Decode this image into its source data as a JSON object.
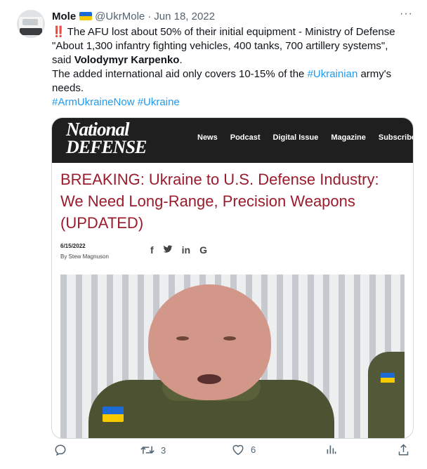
{
  "tweet": {
    "author_name": "Mole",
    "handle": "@UkrMole",
    "separator": "·",
    "date": "Jun 18, 2022",
    "more_label": "···",
    "line1_bang": "‼️",
    "line1": "The AFU lost about 50% of their initial equipment - Ministry of Defense",
    "line2": "\"About 1,300 infantry fighting vehicles, 400 tanks, 700 artillery systems\",",
    "line3_prefix": "said ",
    "line3_name": "Volodymyr Karpenko",
    "line3_suffix": ".",
    "line4_prefix": "The added international aid only covers 10-15% of the ",
    "line4_link": "#Ukrainian",
    "line4_suffix": " army's",
    "line5": "needs.",
    "hashtag1": "#ArmUkraineNow",
    "hashtag2": "#Ukraine"
  },
  "card": {
    "logo_line1": "National",
    "logo_line2": "DEFENSE",
    "nav": [
      "News",
      "Podcast",
      "Digital Issue",
      "Magazine",
      "Subscribe"
    ],
    "headline_line1": "BREAKING: Ukraine to U.S. Defense Industry:",
    "headline_line2": "We Need Long-Range, Precision Weapons",
    "headline_line3": "(UPDATED)",
    "article_date": "6/15/2022",
    "byline": "By Stew Magnuson",
    "share_icons": [
      "f",
      "facebook-icon",
      "twitter-icon",
      "linkedin-icon",
      "google-icon"
    ],
    "share_glyphs": {
      "facebook": "f",
      "twitter": "🐦",
      "linkedin": "in",
      "google": "G"
    }
  },
  "actions": {
    "reply_count": "",
    "retweet_count": "3",
    "like_count": "6",
    "views_count": ""
  },
  "colors": {
    "link": "#1d9bf0",
    "headline": "#9b1c2c",
    "secondary_text": "#536471",
    "flag_blue": "#1c6ad6",
    "flag_yellow": "#f7c900"
  }
}
